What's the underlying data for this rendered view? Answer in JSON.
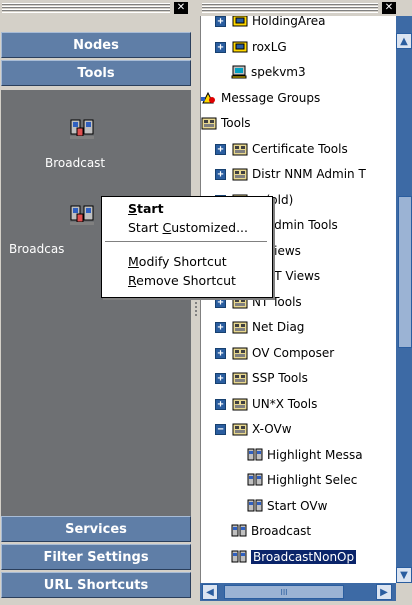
{
  "left_pane": {
    "nav_top": [
      {
        "label": "Nodes"
      },
      {
        "label": "Tools"
      }
    ],
    "tools": [
      {
        "label": "Broadcast",
        "icon": "broadcast-tool-icon"
      },
      {
        "label": "Broadcas",
        "icon": "broadcast-tool-icon"
      }
    ],
    "nav_bottom": [
      {
        "label": "Services"
      },
      {
        "label": "Filter Settings"
      },
      {
        "label": "URL Shortcuts"
      }
    ]
  },
  "context_menu": {
    "items": [
      {
        "label": "Start",
        "accel": "S",
        "bold": true
      },
      {
        "label": "Start Customized...",
        "accel": "C"
      },
      {
        "label": "Modify Shortcut",
        "accel": "M"
      },
      {
        "label": "Remove Shortcut",
        "accel": "R"
      }
    ]
  },
  "tree": {
    "rows": [
      {
        "label": "HoldingArea",
        "icon": "node-group-icon",
        "toggle": "+"
      },
      {
        "label": "roxLG",
        "icon": "node-group-icon",
        "toggle": "+"
      },
      {
        "label": "spekvm3",
        "icon": "computer-icon",
        "toggle": ""
      },
      {
        "label": "Message Groups",
        "icon": "message-groups-icon",
        "toggle": ""
      },
      {
        "label": "Tools",
        "icon": "tool-group-icon",
        "toggle": ""
      },
      {
        "label": "Certificate Tools",
        "icon": "tool-group-icon",
        "toggle": "+"
      },
      {
        "label": "Distr NNM Admin T",
        "icon": "tool-group-icon",
        "toggle": "+"
      },
      {
        "label": "w (old)",
        "icon": "tool-group-icon",
        "toggle": "+"
      },
      {
        "label": "M Admin Tools",
        "icon": "tool-group-icon",
        "toggle": "+"
      },
      {
        "label": "M Views",
        "icon": "tool-group-icon",
        "toggle": "+"
      },
      {
        "label": "M-ET Views",
        "icon": "tool-group-icon",
        "toggle": "+"
      },
      {
        "label": "NT Tools",
        "icon": "tool-group-icon",
        "toggle": "+"
      },
      {
        "label": "Net Diag",
        "icon": "tool-group-icon",
        "toggle": "+"
      },
      {
        "label": "OV Composer",
        "icon": "tool-group-icon",
        "toggle": "+"
      },
      {
        "label": "SSP Tools",
        "icon": "tool-group-icon",
        "toggle": "+"
      },
      {
        "label": "UN*X Tools",
        "icon": "tool-group-icon",
        "toggle": "+"
      },
      {
        "label": "X-OVw",
        "icon": "tool-group-icon",
        "toggle": "−"
      },
      {
        "label": "Highlight Messa",
        "icon": "tool-icon",
        "toggle": ""
      },
      {
        "label": "Highlight Selec",
        "icon": "tool-icon",
        "toggle": ""
      },
      {
        "label": "Start OVw",
        "icon": "tool-icon",
        "toggle": ""
      },
      {
        "label": "Broadcast",
        "icon": "tool-icon",
        "toggle": ""
      },
      {
        "label": "BroadcastNonOp",
        "icon": "tool-icon",
        "toggle": "",
        "selected": true
      }
    ]
  },
  "scrollbars": {
    "up": "▲",
    "down": "▼",
    "left": "◀",
    "right": "▶",
    "thumb": "III"
  },
  "colors": {
    "nav_blue": "#5f7ea7",
    "panel_gray": "#6e7073",
    "selection": "#0a246a",
    "scroll_blue": "#3d6aa5"
  }
}
